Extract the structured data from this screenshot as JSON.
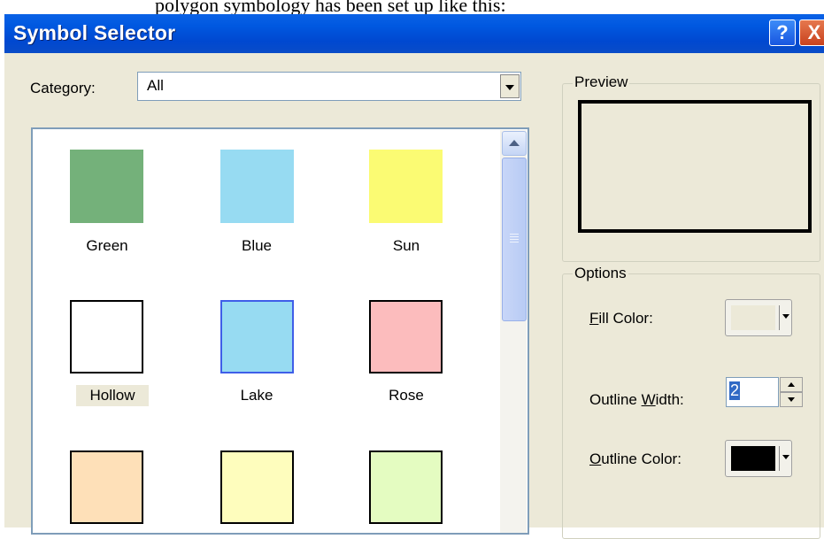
{
  "top_text": "polygon symbology has been set up like this:",
  "window": {
    "title": "Symbol Selector",
    "help_button": "?",
    "close_button": "X"
  },
  "category": {
    "label": "Category:",
    "value": "All"
  },
  "symbols": [
    {
      "label": "Green",
      "fill": "#74b17a",
      "border": "#74b17a"
    },
    {
      "label": "Blue",
      "fill": "#97dbf2",
      "border": "#97dbf2"
    },
    {
      "label": "Sun",
      "fill": "#fbfb73",
      "border": "#fbfb73"
    },
    {
      "label": "Hollow",
      "fill": "#ffffff",
      "border": "#000000",
      "selected": true
    },
    {
      "label": "Lake",
      "fill": "#97dbf2",
      "border": "#3f5ee8"
    },
    {
      "label": "Rose",
      "fill": "#fcbcbd",
      "border": "#000000"
    },
    {
      "label": "",
      "fill": "#fee0b8",
      "border": "#000000"
    },
    {
      "label": "",
      "fill": "#fefdbd",
      "border": "#000000"
    },
    {
      "label": "",
      "fill": "#e4fcc1",
      "border": "#000000"
    }
  ],
  "preview": {
    "title": "Preview"
  },
  "options": {
    "title": "Options",
    "fill_color": {
      "label_hotkey": "F",
      "label_rest": "ill Color:",
      "color": "#ece9d8"
    },
    "outline_width": {
      "label_pre": "Outline ",
      "label_hotkey": "W",
      "label_rest": "idth:",
      "value": "2"
    },
    "outline_color": {
      "label_hotkey": "O",
      "label_rest": "utline Color:",
      "color": "#000000"
    }
  }
}
